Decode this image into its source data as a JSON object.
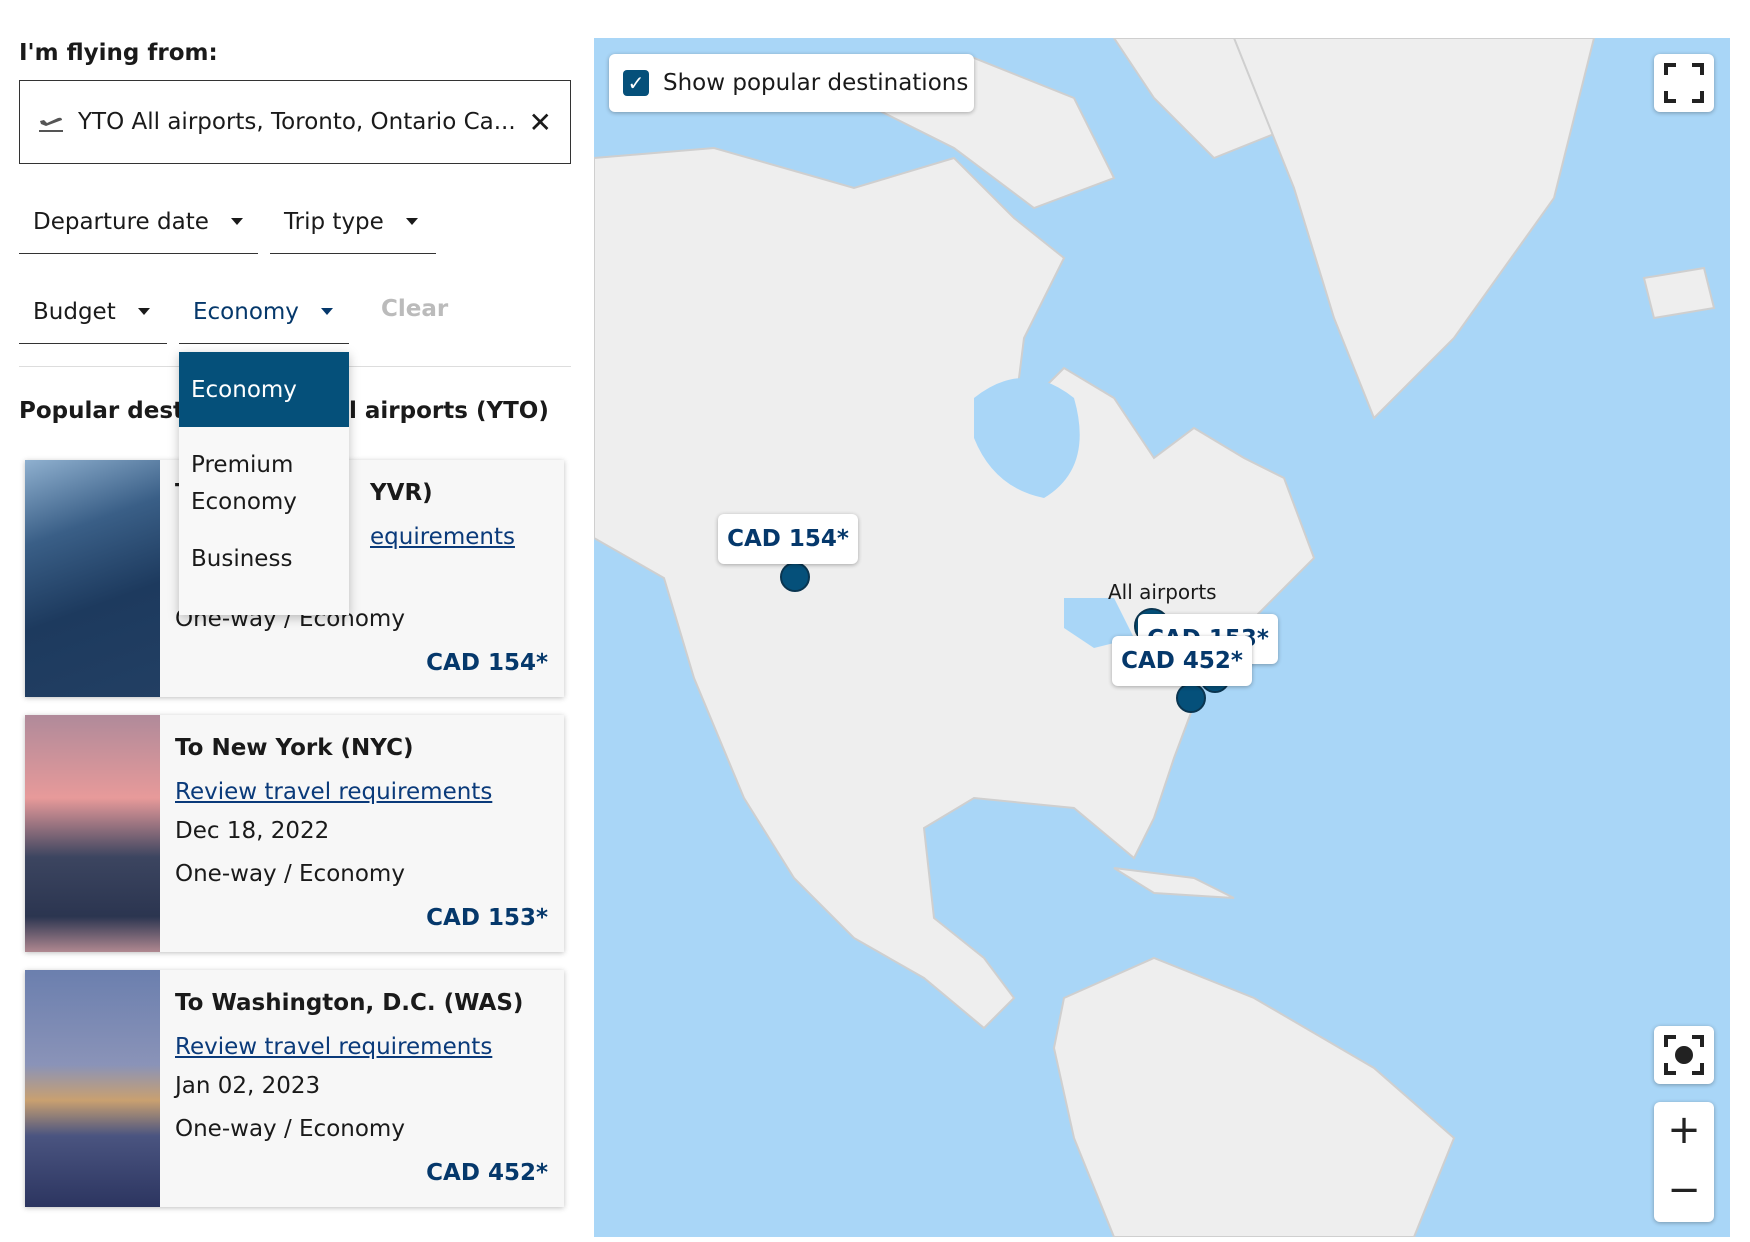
{
  "search": {
    "label": "I'm flying from:",
    "origin_value": "YTO All airports, Toronto, Ontario Ca...",
    "clear_icon": "close-icon",
    "origin_icon": "plane-departure-icon"
  },
  "filters": {
    "departure_date": "Departure date",
    "trip_type": "Trip type",
    "budget": "Budget",
    "cabin": "Economy",
    "clear": "Clear"
  },
  "cabin_menu": {
    "options": [
      "Economy",
      "Premium Economy",
      "Business"
    ],
    "selected": "Economy"
  },
  "popular": {
    "heading_left": "Popular destin",
    "heading_right": "l airports (YTO)"
  },
  "cards": [
    {
      "title_left": "T",
      "title_right": "YVR)",
      "link_partial": "equirements",
      "trip": "One-way / Economy",
      "price": "CAD 154*"
    },
    {
      "title": "To New York (NYC)",
      "link": "Review travel requirements",
      "date": "Dec 18, 2022",
      "trip": "One-way / Economy",
      "price": "CAD 153*"
    },
    {
      "title": "To Washington, D.C. (WAS)",
      "link": "Review travel requirements",
      "date": "Jan 02, 2023",
      "trip": "One-way / Economy",
      "price": "CAD 452*"
    }
  ],
  "map": {
    "show_popular_label": "Show popular destinations",
    "show_popular_checked": true,
    "origin_label": "All airports",
    "price_tags": [
      "CAD 154*",
      "CAD 153*",
      "CAD 452*"
    ],
    "water_color": "#a9d6f7",
    "land_color": "#eeeeee",
    "marker_color": "#05507a"
  }
}
